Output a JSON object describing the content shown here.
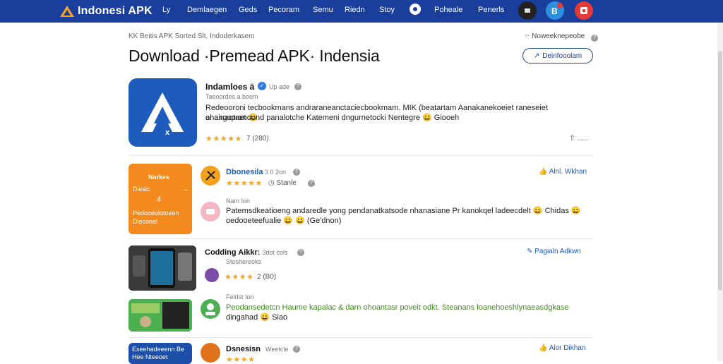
{
  "header": {
    "logo_text": "Indonesi APK",
    "nav": [
      "Ly",
      "Demlaegen",
      "Geds",
      "Pecoram",
      "Semu",
      "Riedn",
      "Stoy",
      "Poheale",
      "Penerls"
    ]
  },
  "breadcrumb": "KK Beitis  APK Sorted Slt. Indoderkasem",
  "top_right_note": "Noweeknepeobe",
  "page_title": "Download ·Premead APK· Indensia",
  "download_button": "Deinfooolam",
  "featured": {
    "name": "Indamloes ä",
    "badge": "Up ade",
    "subtitle": "Taeoordes a boem",
    "description_line1": "Redeooroni tecbookmans andraraneanctaciecbookmam. MIK (beatartam Aanakanekoeiet raneseiet anainaqtaet 😀",
    "description_line2": "ohangooronoond panalotche Katemeni dngurnetocki Nentegre 😀 Giooeh",
    "stars": "★★★★★",
    "rating_count": "7  (280)",
    "share_label": "⇧ ....."
  },
  "item1": {
    "card_title": "Narkes",
    "card_sub": "Diesic",
    "card_number": "4",
    "card_foot": "Pedooeoiotoeen Dieconel",
    "name": "Dbonesila",
    "meta": "3 0 2on",
    "stars": "★★★★★",
    "rating_note": "Stanle",
    "action": "Alnl. Wkhan",
    "review_label": "Nam Ion",
    "review_line1": "Patemsdkeatioeng andaredle yong pendanatkatsode nhanasiane Pr kanokqel ladeecdelt 😀 Chidas 😀",
    "review_line2": "oedooeteefualie 😀 😀 (Ge'dnon)"
  },
  "item2": {
    "name": "Codding Aikkr",
    "meta": "1 3dot cols",
    "sub": "Stoshereoks",
    "stars": "★★★★",
    "rating_note": "2  (B0)",
    "action": "Pagialn Adkwn",
    "review_label": "Feldst Ion",
    "review_line1": "Peodansedetcn Haume kapalac & darn ohoantasr poveit odkt. Steanans loanehoeshlynaeasdgkase",
    "review_line2": "dingahad 😀 Siao"
  },
  "item3": {
    "name": "Dsnesisn",
    "meta": "Weetcle",
    "card_text": "Exeehadeeenn Be Hee Nteeoet",
    "stars": "★★★★",
    "action": "Alor Dikhan"
  },
  "colors": {
    "brand": "#1a3e9c",
    "accent_link": "#1a5cc2",
    "star": "#f5a623",
    "orange": "#f48a1e",
    "green_text": "#3e8e1a"
  }
}
